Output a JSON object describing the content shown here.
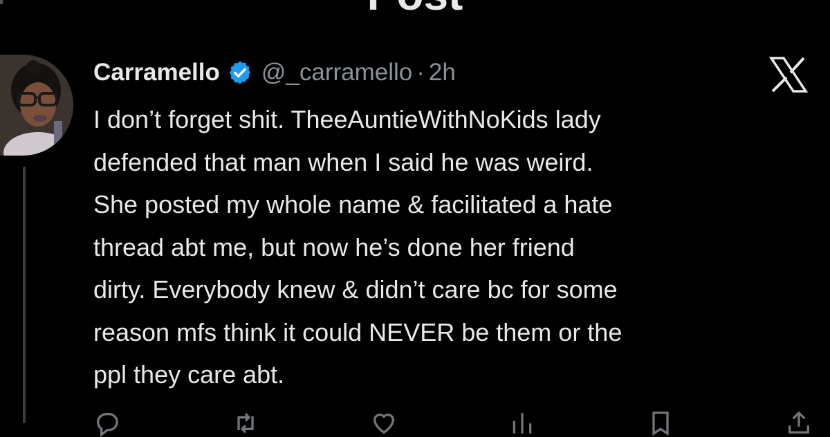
{
  "page": {
    "title": "Post"
  },
  "tweet": {
    "author_display_name": "Carramello",
    "verified": true,
    "handle": "@_carramello",
    "separator": "·",
    "time": "2h",
    "text": "I don’t forget shit. TheeAuntieWithNoKids lady\ndefended that man when I said he was weird.\nShe posted my whole name & facilitated a hate\nthread abt me, but now he’s done her friend\ndirty. Everybody knew & didn’t care bc for some\nreason mfs think it could NEVER be them or the\nppl they care abt."
  },
  "icons": {
    "avatar": "avatar",
    "verified": "verified-badge-icon",
    "brand": "x-logo-icon",
    "reply": "reply-icon",
    "repost": "repost-icon",
    "like": "heart-icon",
    "views": "views-icon",
    "bookmark": "bookmark-icon",
    "share": "share-icon"
  },
  "colors": {
    "background": "#000000",
    "text": "#e7e9ea",
    "secondary_text": "#8b9298",
    "verified_blue": "#1d9bf0",
    "thread_line": "#3a3c3e"
  }
}
